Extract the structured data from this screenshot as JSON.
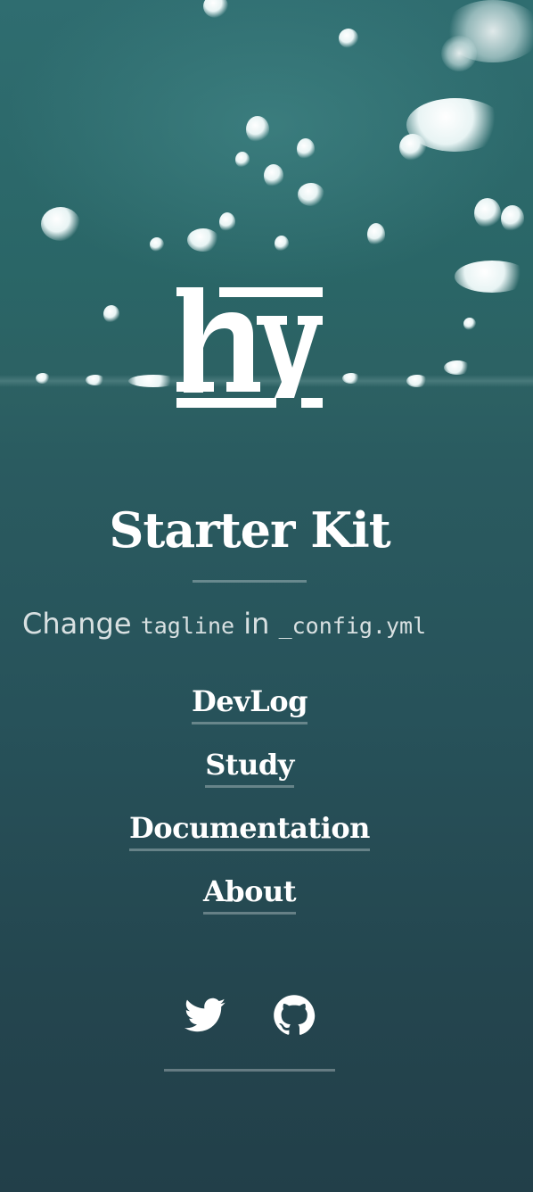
{
  "site": {
    "logo_icon": "hy-logo",
    "title": "Starter Kit",
    "tagline": {
      "text_change": "Change",
      "code_tagline": "tagline",
      "text_in": "in",
      "code_config": "_config.yml"
    }
  },
  "nav": {
    "items": [
      {
        "label": "DevLog"
      },
      {
        "label": "Study"
      },
      {
        "label": "Documentation"
      },
      {
        "label": "About"
      }
    ]
  },
  "social": {
    "items": [
      {
        "icon": "twitter-icon"
      },
      {
        "icon": "github-icon"
      }
    ]
  },
  "colors": {
    "background_top": "#2f6d70",
    "background_bottom": "#223f49",
    "text": "#ffffff",
    "divider": "rgba(255,255,255,0.3)"
  }
}
